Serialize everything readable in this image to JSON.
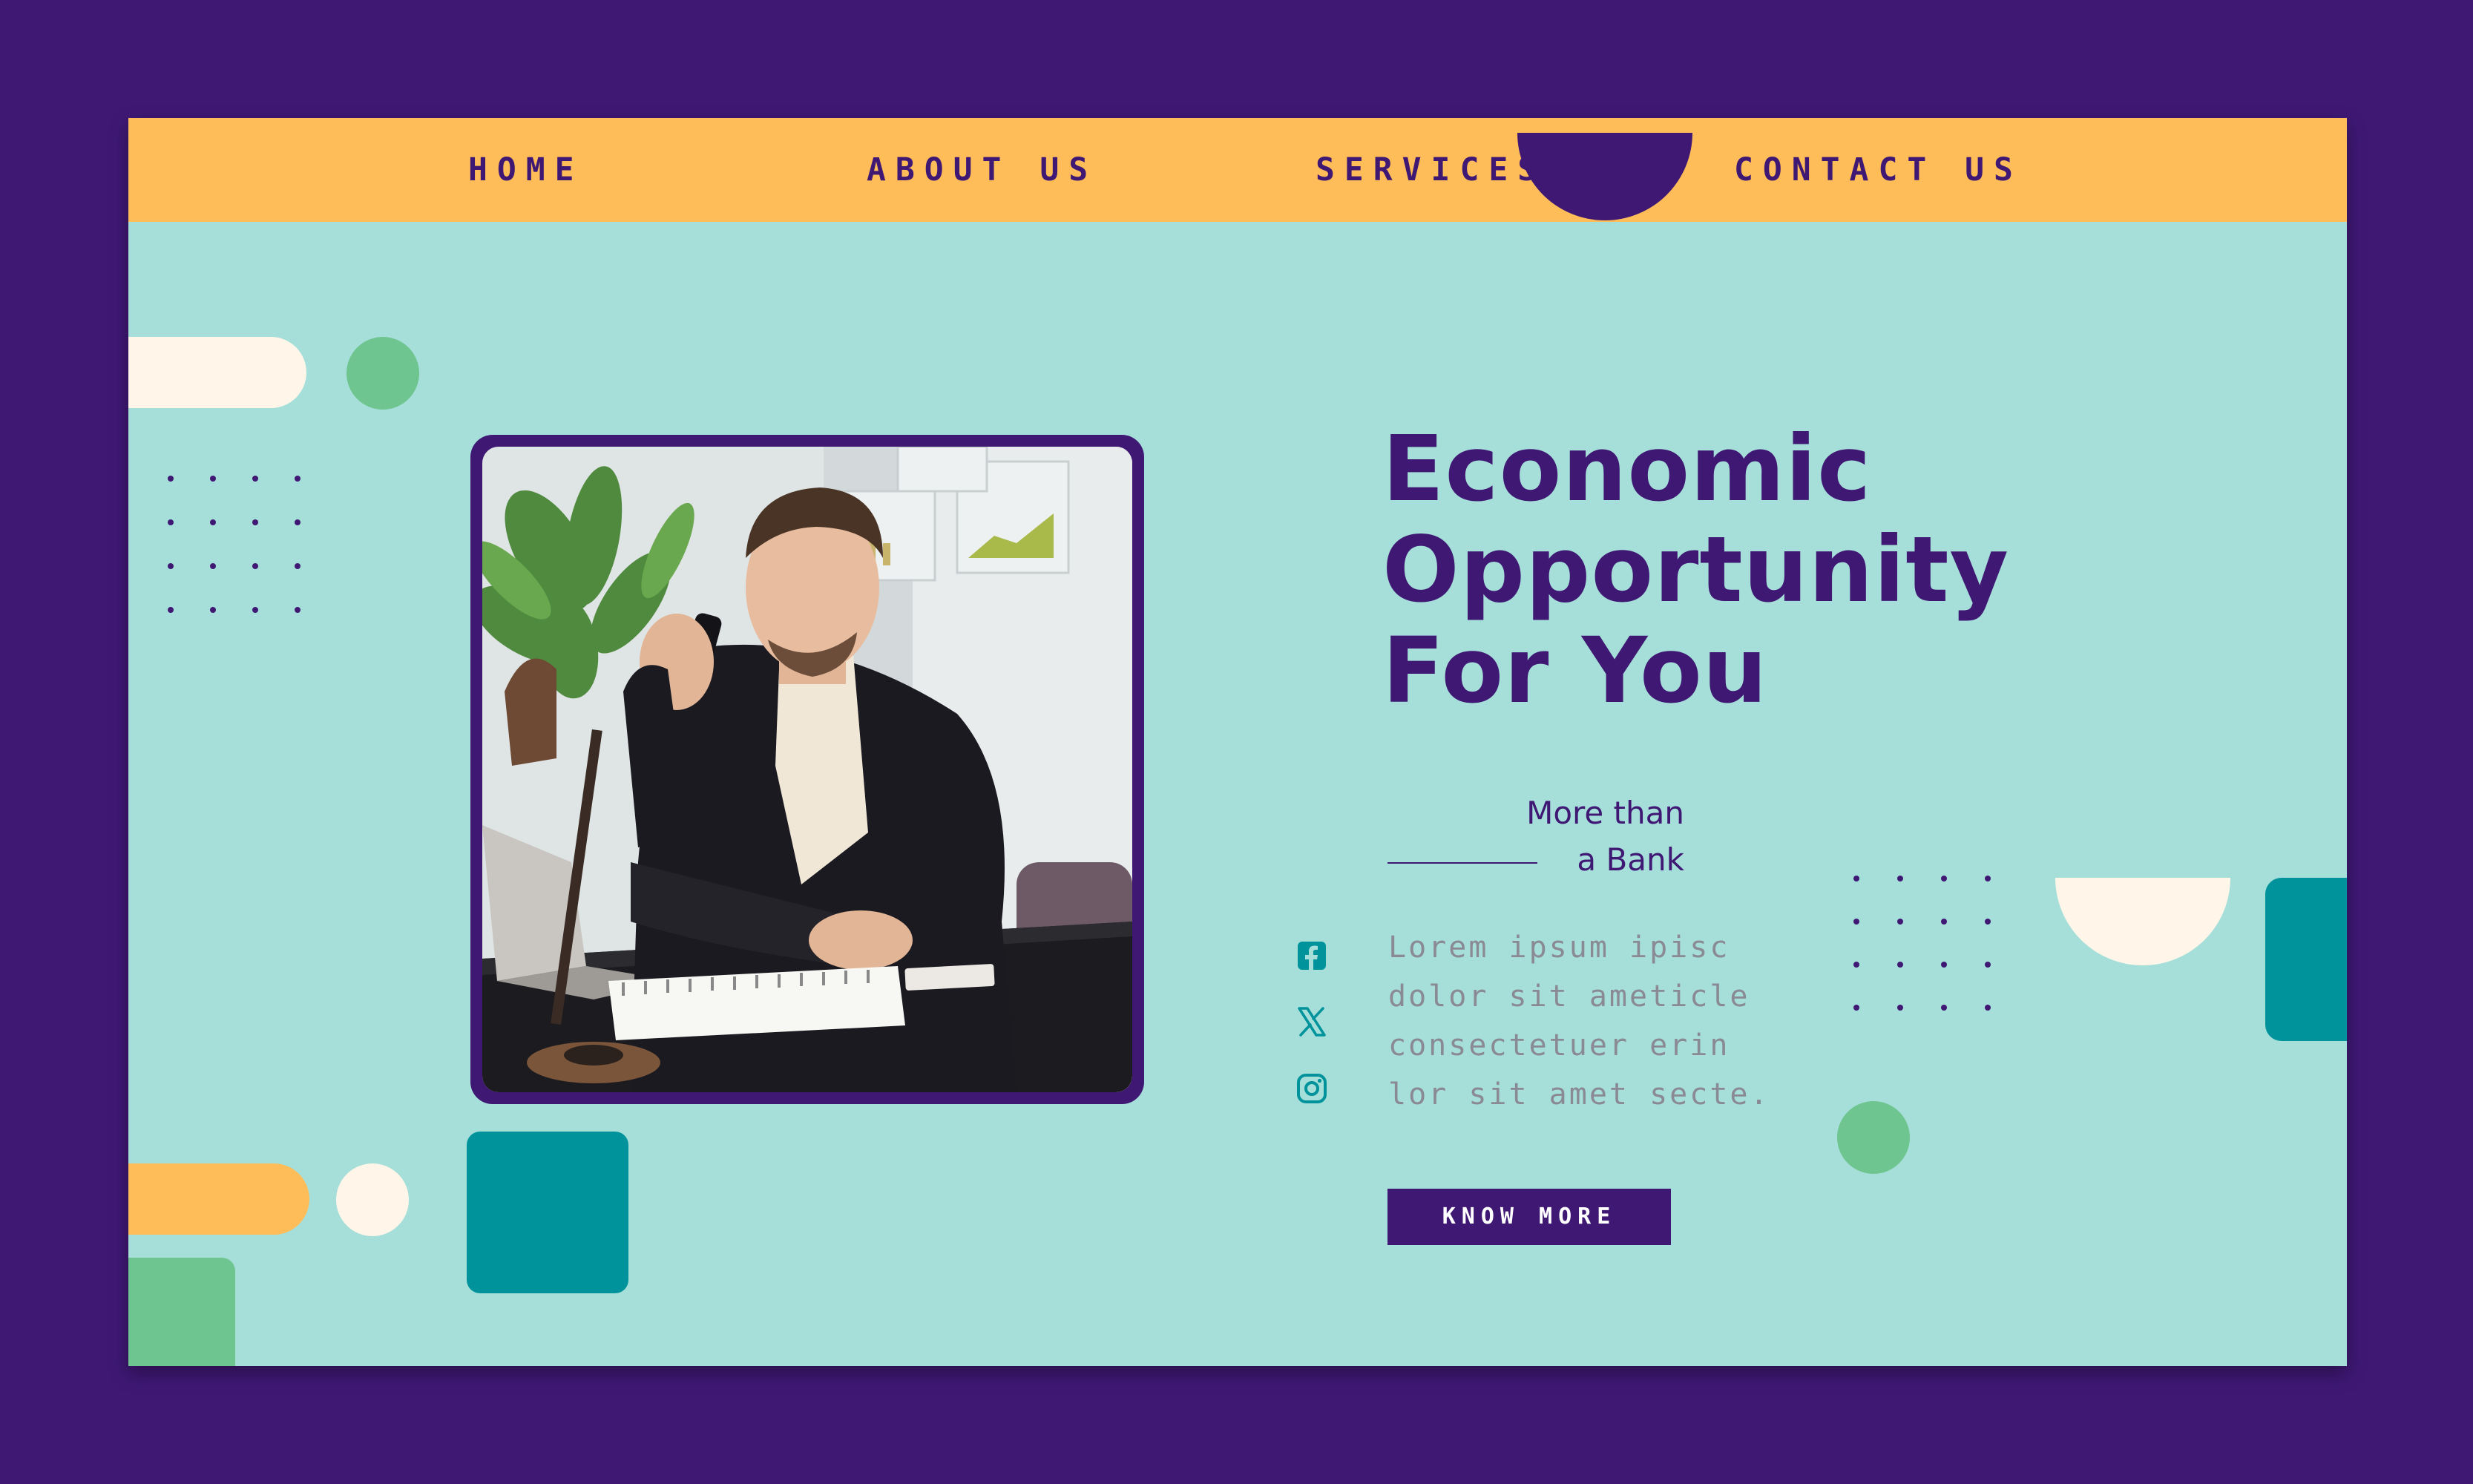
{
  "colors": {
    "background": "#3f1874",
    "card": "#a6dfda",
    "nav": "#ffbd59",
    "accent_purple": "#3f1874",
    "teal": "#00939b",
    "green": "#6fc58f",
    "cream": "#fff6e9",
    "muted_text": "#8a8a94"
  },
  "nav": {
    "items": [
      {
        "label": "HOME"
      },
      {
        "label": "ABOUT US"
      },
      {
        "label": "SERVICES"
      },
      {
        "label": "CONTACT US"
      }
    ]
  },
  "hero": {
    "headline": [
      "Economic",
      "Opportunity",
      "For You"
    ],
    "tagline_line1": "More than",
    "tagline_line2": "a Bank",
    "body": [
      "Lorem ipsum ipisc",
      "dolor sit ameticle",
      "consectetuer erin",
      "lor sit amet secte."
    ],
    "cta_label": "KNOW MORE",
    "photo_alt": "Businessman in a black blazer talking on a phone at his desk"
  },
  "social": [
    {
      "icon": "facebook-icon"
    },
    {
      "icon": "x-twitter-icon"
    },
    {
      "icon": "instagram-icon"
    }
  ]
}
